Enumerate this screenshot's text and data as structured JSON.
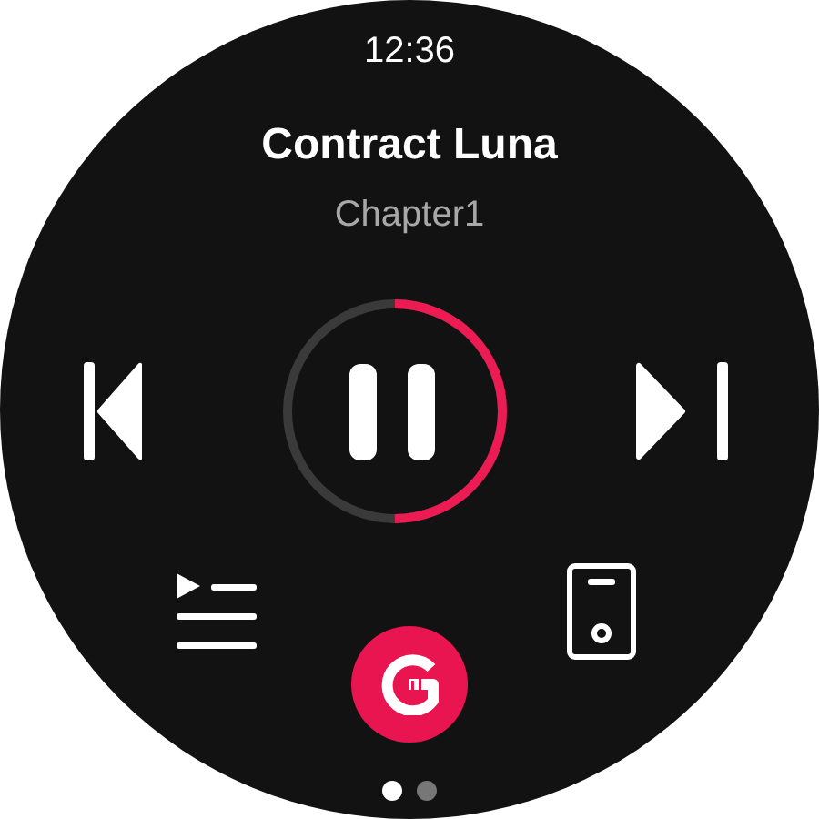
{
  "status": {
    "time": "12:36"
  },
  "track": {
    "title": "Contract Luna",
    "chapter": "Chapter1"
  },
  "playback": {
    "playing": true,
    "level": 0.5
  },
  "pages": [
    {
      "selected": true
    },
    {
      "selected": false
    }
  ]
}
